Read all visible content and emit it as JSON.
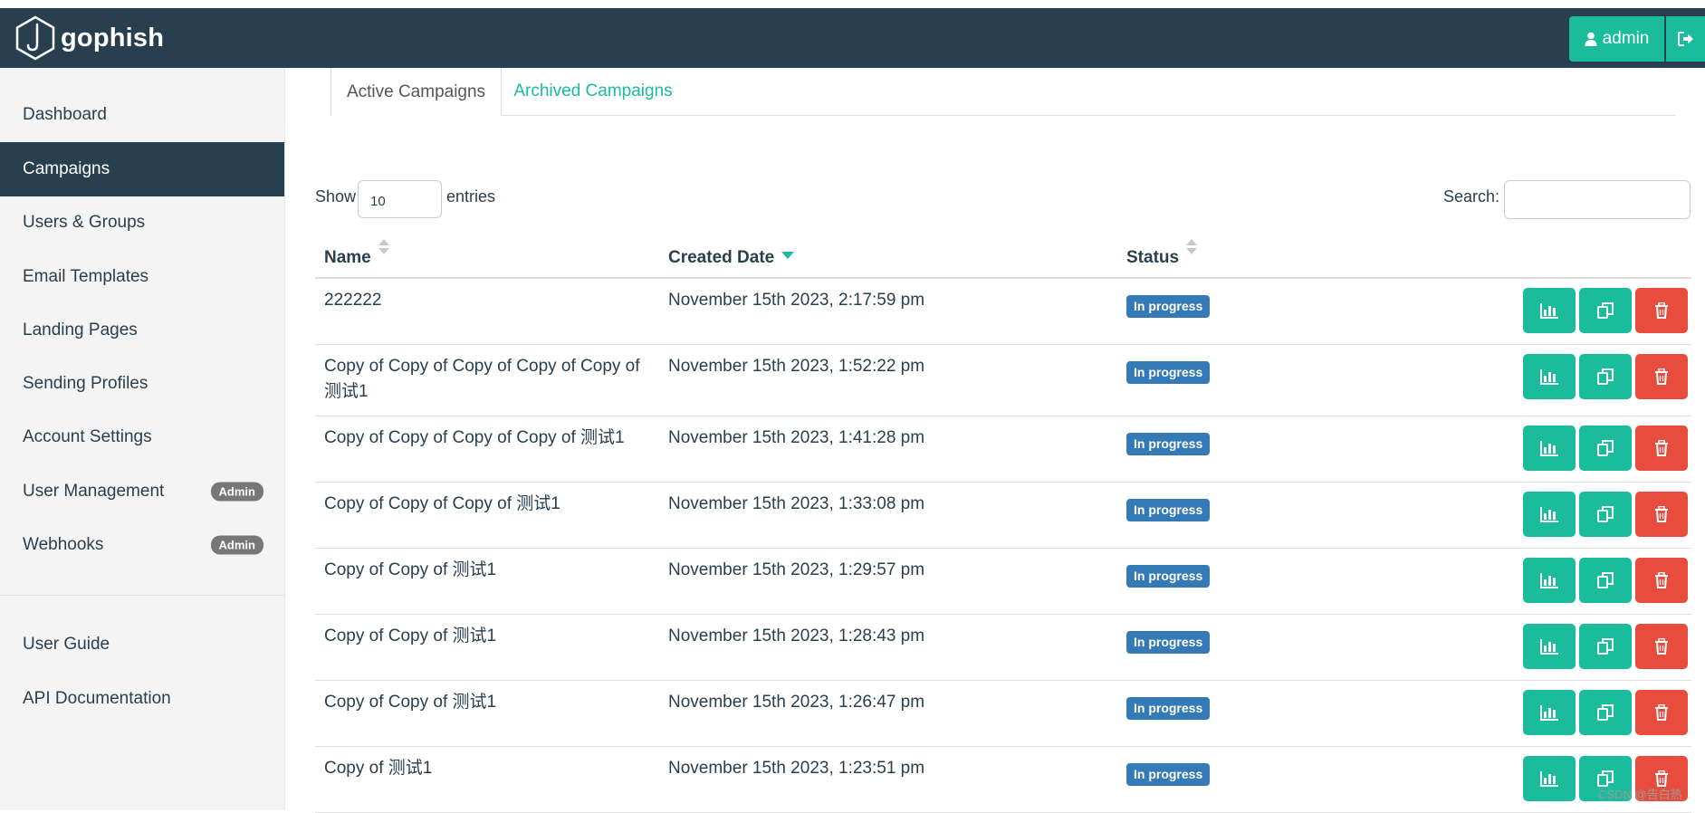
{
  "app": {
    "name": "gophish"
  },
  "navbar": {
    "user_label": "admin"
  },
  "sidebar": {
    "items": [
      {
        "label": "Dashboard",
        "badge": ""
      },
      {
        "label": "Campaigns",
        "badge": "",
        "active": true
      },
      {
        "label": "Users & Groups",
        "badge": ""
      },
      {
        "label": "Email Templates",
        "badge": ""
      },
      {
        "label": "Landing Pages",
        "badge": ""
      },
      {
        "label": "Sending Profiles",
        "badge": ""
      },
      {
        "label": "Account Settings",
        "badge": ""
      },
      {
        "label": "User Management",
        "badge": "Admin"
      },
      {
        "label": "Webhooks",
        "badge": "Admin"
      }
    ],
    "footer_items": [
      {
        "label": "User Guide"
      },
      {
        "label": "API Documentation"
      }
    ]
  },
  "tabs": [
    {
      "label": "Active Campaigns",
      "active": true
    },
    {
      "label": "Archived Campaigns",
      "active": false
    }
  ],
  "controls": {
    "show_label": "Show",
    "entries_value": "10",
    "entries_label": "entries",
    "search_label": "Search:",
    "search_value": ""
  },
  "table": {
    "columns": [
      "Name",
      "Created Date",
      "Status"
    ],
    "rows": [
      {
        "name": "222222",
        "created": "November 15th 2023, 2:17:59 pm",
        "status": "In progress"
      },
      {
        "name": "Copy of Copy of Copy of Copy of Copy of 测试1",
        "created": "November 15th 2023, 1:52:22 pm",
        "status": "In progress"
      },
      {
        "name": "Copy of Copy of Copy of Copy of 测试1",
        "created": "November 15th 2023, 1:41:28 pm",
        "status": "In progress"
      },
      {
        "name": "Copy of Copy of Copy of 测试1",
        "created": "November 15th 2023, 1:33:08 pm",
        "status": "In progress"
      },
      {
        "name": "Copy of Copy of 测试1",
        "created": "November 15th 2023, 1:29:57 pm",
        "status": "In progress"
      },
      {
        "name": "Copy of Copy of 测试1",
        "created": "November 15th 2023, 1:28:43 pm",
        "status": "In progress"
      },
      {
        "name": "Copy of Copy of 测试1",
        "created": "November 15th 2023, 1:26:47 pm",
        "status": "In progress"
      },
      {
        "name": "Copy of 测试1",
        "created": "November 15th 2023, 1:23:51 pm",
        "status": "In progress"
      }
    ]
  },
  "watermark": "CSDN @告白热",
  "colors": {
    "navbar": "#283f50",
    "accent": "#1abc9c",
    "danger": "#e74c3c",
    "status_badge": "#337ab7",
    "admin_badge": "#777777"
  },
  "icons": [
    "gophish-logo-icon",
    "user-icon",
    "logout-icon",
    "sort-icon",
    "sort-desc-icon",
    "chart-icon",
    "copy-icon",
    "trash-icon"
  ]
}
